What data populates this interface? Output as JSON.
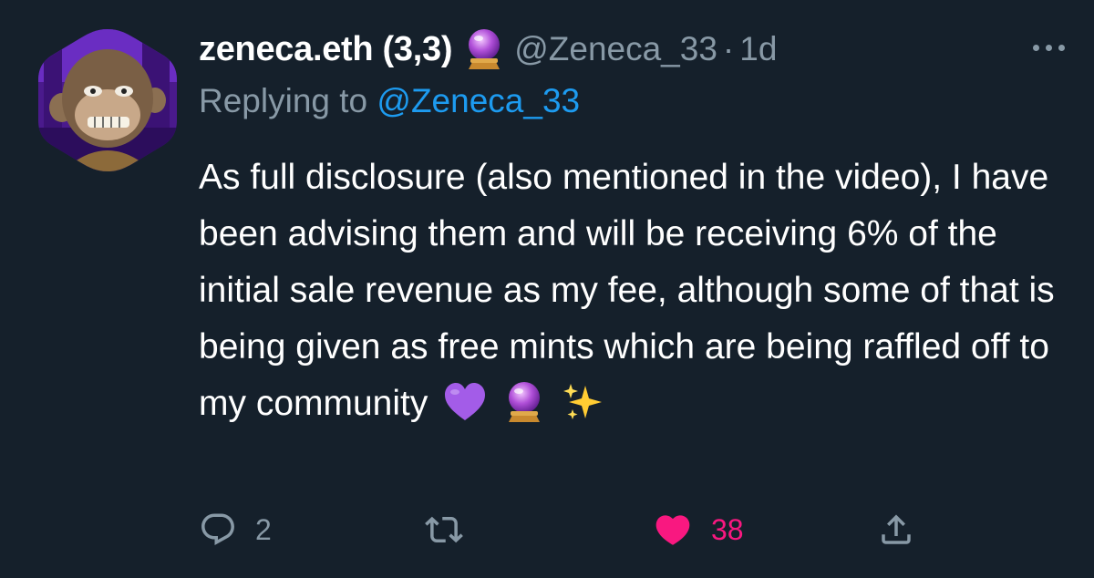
{
  "tweet": {
    "display_name": "zeneca.eth (3,3)",
    "name_emoji": "crystal-ball",
    "handle": "@Zeneca_33",
    "separator": "·",
    "time": "1d",
    "replying_prefix": "Replying to",
    "replying_handle": "@Zeneca_33",
    "text": "As full disclosure (also mentioned in the video), I have been advising them and will be receiving 6% of the initial sale revenue as my fee, although some of that is being given as free mints which are being raffled off to my community",
    "trailing_emojis": [
      "purple-heart",
      "crystal-ball",
      "sparkles"
    ]
  },
  "actions": {
    "reply_icon": "reply-icon",
    "reply_count": "2",
    "retweet_icon": "retweet-icon",
    "like_icon": "heart-icon",
    "like_count": "38",
    "like_active": true,
    "share_icon": "share-icon"
  },
  "colors": {
    "background": "#15202b",
    "secondary_text": "#8899a6",
    "mention": "#1d9bf0",
    "like": "#f91880"
  }
}
